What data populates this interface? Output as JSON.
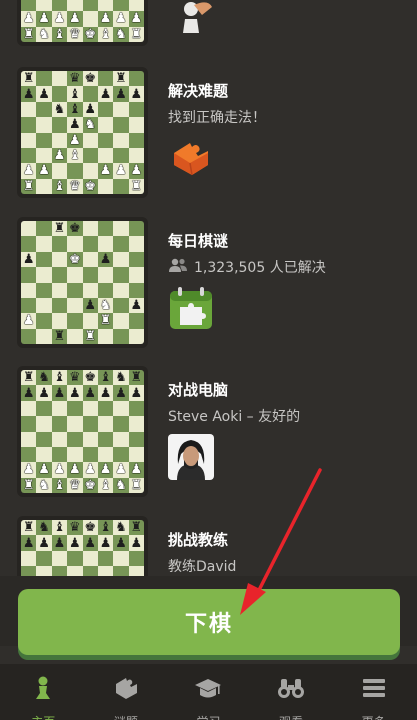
{
  "cards": [
    {
      "title": "",
      "subtitle": "",
      "art_icon": "pawn-hand-icon",
      "board": [
        "........",
        "........",
        "........",
        "........",
        "........",
        "........",
        "PPPP.PPP",
        "RNBQKBNR"
      ]
    },
    {
      "title": "解决难题",
      "subtitle": "找到正确走法！",
      "art_icon": "puzzle-piece-icon",
      "board": [
        "r..qk.r.",
        "pp.b.ppp",
        "..nbp...",
        "...pN...",
        "...P....",
        "..PB....",
        "PP...PPP",
        "R.BQK..R"
      ]
    },
    {
      "title": "每日棋谜",
      "subtitle_icon": "people-icon",
      "subtitle": "1,323,505 人已解决",
      "art_icon": "daily-puzzle-calendar-icon",
      "board": [
        "..rk....",
        "........",
        "p..K.p..",
        "........",
        "........",
        "....pN.p",
        "P....R..",
        "..r.R..."
      ]
    },
    {
      "title": "对战电脑",
      "subtitle": "Steve Aoki – 友好的",
      "art_icon": "steve-aoki-avatar",
      "board": [
        "rnbqkbnr",
        "pppppppp",
        "........",
        "........",
        "........",
        "........",
        "PPPPPPPP",
        "RNBQKBNR"
      ]
    },
    {
      "title": "挑战教练",
      "subtitle": "教练David",
      "art_icon": "",
      "board": [
        "rnbqkbnr",
        "pppppppp",
        "........",
        "........",
        "........",
        "........",
        "........",
        "........"
      ]
    }
  ],
  "play_button": {
    "label": "下棋"
  },
  "tabs": [
    {
      "label": "主页",
      "icon": "home-pawn-icon",
      "active": true
    },
    {
      "label": "谜题",
      "icon": "puzzle-icon",
      "active": false
    },
    {
      "label": "学习",
      "icon": "graduation-cap-icon",
      "active": false
    },
    {
      "label": "观看",
      "icon": "binoculars-icon",
      "active": false
    },
    {
      "label": "更多",
      "icon": "menu-icon",
      "active": false
    }
  ],
  "colors": {
    "background": "#302e2b",
    "board_light": "#ebecd0",
    "board_dark": "#779556",
    "accent_green": "#81b64c",
    "tab_inactive": "#a6a5a3",
    "annotation_arrow": "#e8242b"
  }
}
